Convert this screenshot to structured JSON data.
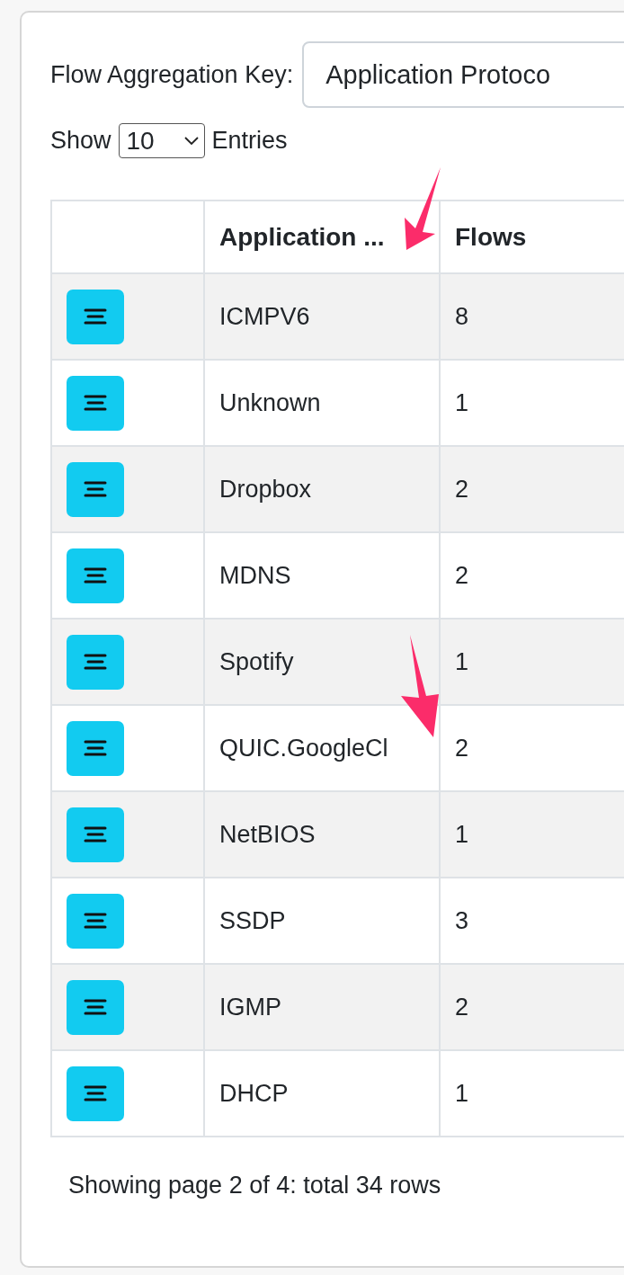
{
  "aggregation": {
    "label": "Flow Aggregation Key:",
    "value": "Application Protoco"
  },
  "page_size": {
    "before": "Show",
    "value": "10",
    "after": "Entries"
  },
  "table": {
    "columns": [
      "Application ...",
      "Flows"
    ],
    "rows": [
      {
        "application": "ICMPV6",
        "flows": "8"
      },
      {
        "application": "Unknown",
        "flows": "1"
      },
      {
        "application": "Dropbox",
        "flows": "2"
      },
      {
        "application": "MDNS",
        "flows": "2"
      },
      {
        "application": "Spotify",
        "flows": "1"
      },
      {
        "application": "QUIC.GoogleCl",
        "flows": "2"
      },
      {
        "application": "NetBIOS",
        "flows": "1"
      },
      {
        "application": "SSDP",
        "flows": "3"
      },
      {
        "application": "IGMP",
        "flows": "2"
      },
      {
        "application": "DHCP",
        "flows": "1"
      }
    ]
  },
  "footer": "Showing page 2 of 4: total 34 rows"
}
